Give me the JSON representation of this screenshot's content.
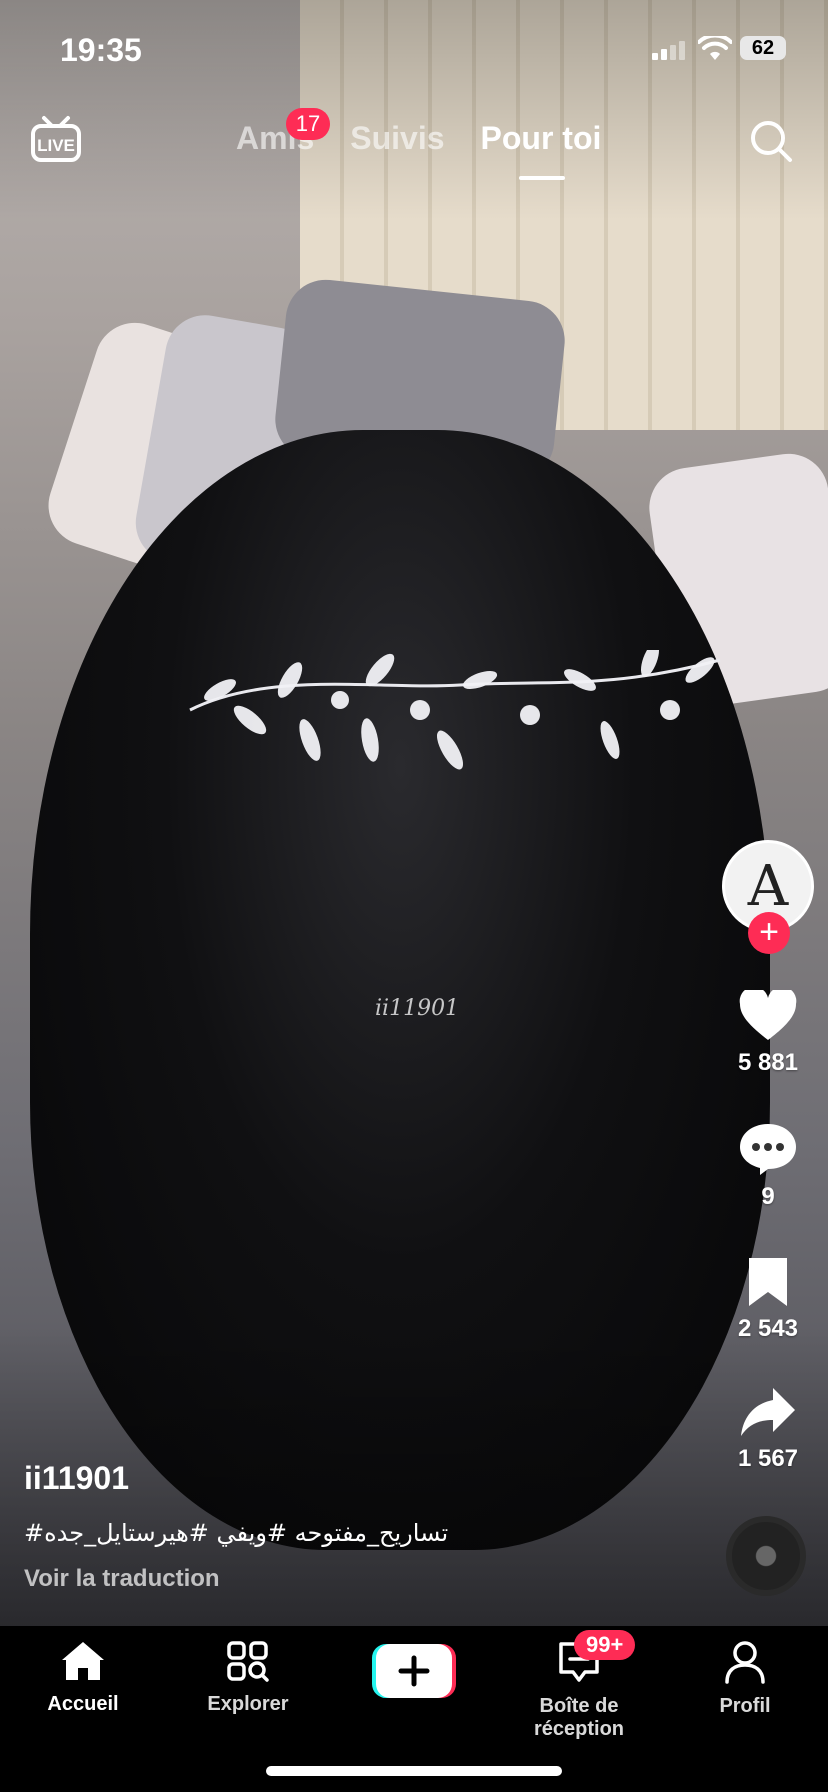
{
  "status_bar": {
    "time": "19:35",
    "battery": "62"
  },
  "top_nav": {
    "tabs": [
      {
        "label": "Amis",
        "badge": "17"
      },
      {
        "label": "Suivis"
      },
      {
        "label": "Pour toi",
        "active": true
      }
    ],
    "live_icon": "live-tv-icon",
    "search_icon": "search-icon"
  },
  "video": {
    "watermark": "ii11901"
  },
  "actions": {
    "likes": "5 881",
    "comments": "9",
    "saves": "2 543",
    "shares": "1 567"
  },
  "caption": {
    "username": "ii11901",
    "description": "#تساريح_مفتوحه #ويفي #هيرستايل_جده",
    "translate": "Voir la traduction"
  },
  "bottom_nav": {
    "items": [
      {
        "label": "Accueil",
        "icon": "home-icon"
      },
      {
        "label": "Explorer",
        "icon": "explore-icon"
      },
      {
        "label": "",
        "icon": "plus-icon"
      },
      {
        "label": "Boîte de réception",
        "icon": "inbox-icon",
        "badge": "99+"
      },
      {
        "label": "Profil",
        "icon": "profile-icon"
      }
    ]
  },
  "colors": {
    "accent": "#fe2c55",
    "cyan": "#25f4ee"
  }
}
